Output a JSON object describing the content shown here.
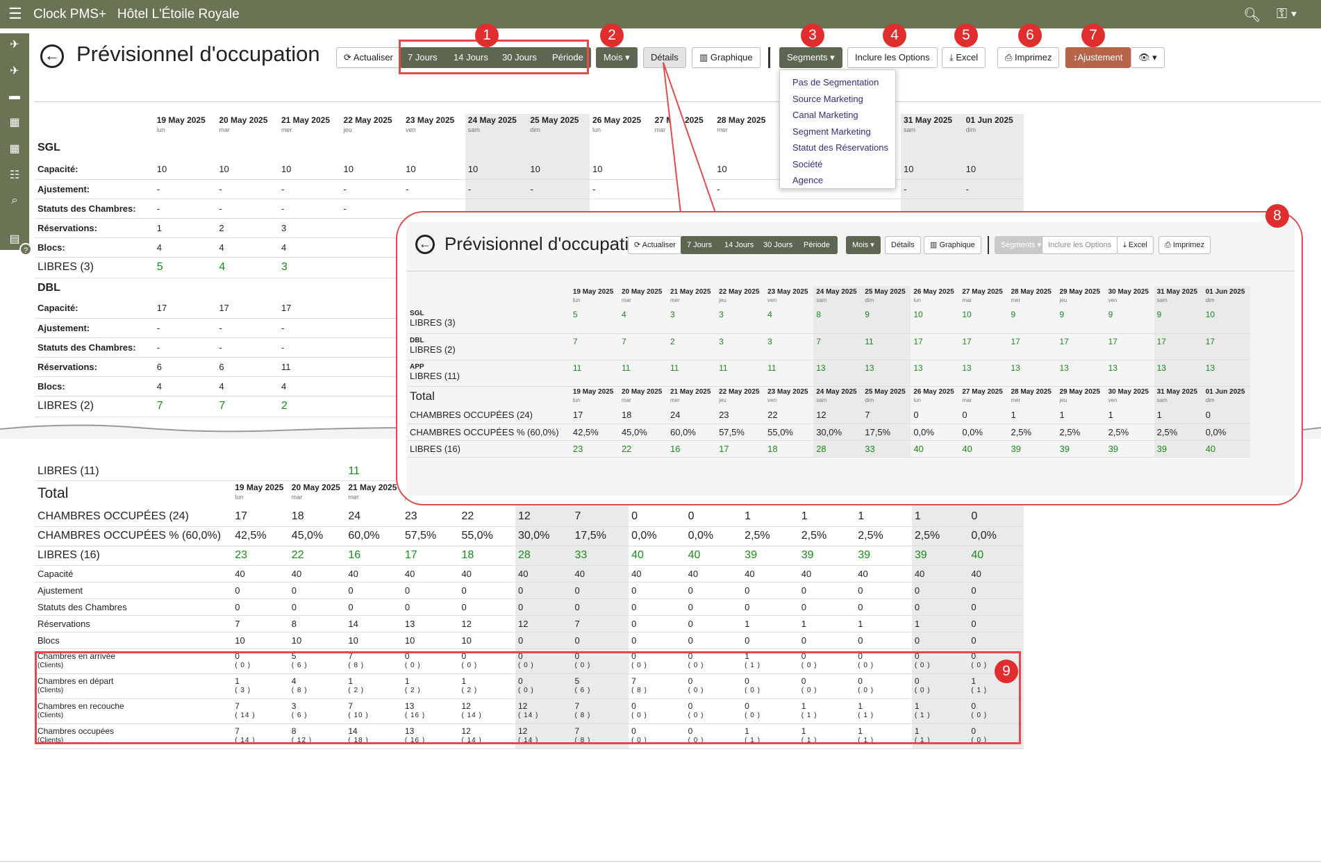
{
  "app": {
    "name": "Clock PMS+",
    "hotel": "Hôtel L'Étoile Royale"
  },
  "page": {
    "title": "Prévisionnel d'occupation"
  },
  "toolbar": {
    "refresh": "Actualiser",
    "d7": "7 Jours",
    "d14": "14 Jours",
    "d30": "30 Jours",
    "period": "Période",
    "month": "Mois",
    "details": "Détails",
    "graph": "Graphique",
    "segments": "Segments",
    "options": "Inclure les Options",
    "excel": "Excel",
    "print": "Imprimez",
    "adjust": "Ajustement"
  },
  "badges": [
    "1",
    "2",
    "3",
    "4",
    "5",
    "6",
    "7",
    "8",
    "9"
  ],
  "segment_menu": [
    "Pas de Segmentation",
    "Source Marketing",
    "Canal Marketing",
    "Segment Marketing",
    "Statut des Réservations",
    "Société",
    "Agence"
  ],
  "dates": [
    {
      "d": "19 May 2025",
      "w": "lun"
    },
    {
      "d": "20 May 2025",
      "w": "mar"
    },
    {
      "d": "21 May 2025",
      "w": "mer"
    },
    {
      "d": "22 May 2025",
      "w": "jeu"
    },
    {
      "d": "23 May 2025",
      "w": "ven"
    },
    {
      "d": "24 May 2025",
      "w": "sam"
    },
    {
      "d": "25 May 2025",
      "w": "dim"
    },
    {
      "d": "26 May 2025",
      "w": "lun"
    },
    {
      "d": "27 May 2025",
      "w": "mar"
    },
    {
      "d": "28 May 2025",
      "w": "mer"
    },
    {
      "d": "29 May 2025",
      "w": "jeu"
    },
    {
      "d": "30 May 2025",
      "w": "ven"
    },
    {
      "d": "31 May 2025",
      "w": "sam"
    },
    {
      "d": "01 Jun 2025",
      "w": "dim"
    }
  ],
  "main": {
    "sgl": {
      "name": "SGL",
      "rows": [
        {
          "label": "Capacité:",
          "vals": [
            "10",
            "10",
            "10",
            "10",
            "10",
            "10",
            "10",
            "10",
            "",
            "10",
            "",
            "",
            "10",
            "10"
          ]
        },
        {
          "label": "Ajustement:",
          "vals": [
            "-",
            "-",
            "-",
            "-",
            "-",
            "-",
            "-",
            "-",
            "",
            "-",
            "",
            "",
            "-",
            "-"
          ]
        },
        {
          "label": "Statuts des Chambres:",
          "vals": [
            "-",
            "-",
            "-",
            "-"
          ]
        },
        {
          "label": "Réservations:",
          "vals": [
            "1",
            "2",
            "3"
          ]
        },
        {
          "label": "Blocs:",
          "vals": [
            "4",
            "4",
            "4"
          ]
        }
      ],
      "free": {
        "label": "LIBRES (3)",
        "vals": [
          "5",
          "4",
          "3"
        ]
      }
    },
    "dbl": {
      "name": "DBL",
      "rows": [
        {
          "label": "Capacité:",
          "vals": [
            "17",
            "17",
            "17"
          ]
        },
        {
          "label": "Ajustement:",
          "vals": [
            "-",
            "-",
            "-"
          ]
        },
        {
          "label": "Statuts des Chambres:",
          "vals": [
            "-",
            "-",
            "-"
          ]
        },
        {
          "label": "Réservations:",
          "vals": [
            "6",
            "6",
            "11"
          ]
        },
        {
          "label": "Blocs:",
          "vals": [
            "4",
            "4",
            "4"
          ]
        }
      ],
      "free": {
        "label": "LIBRES (2)",
        "vals": [
          "7",
          "7",
          "2"
        ]
      }
    },
    "app_free": {
      "label": "LIBRES (11)",
      "vals": [
        "",
        "",
        "11"
      ]
    },
    "total": {
      "title": "Total",
      "occ": {
        "label": "CHAMBRES OCCUPÉES (24)",
        "vals": [
          "17",
          "18",
          "24",
          "23",
          "22",
          "12",
          "7",
          "0",
          "0",
          "1",
          "1",
          "1",
          "1",
          "0"
        ]
      },
      "pct": {
        "label": "CHAMBRES OCCUPÉES % (60,0%)",
        "vals": [
          "42,5%",
          "45,0%",
          "60,0%",
          "57,5%",
          "55,0%",
          "30,0%",
          "17,5%",
          "0,0%",
          "0,0%",
          "2,5%",
          "2,5%",
          "2,5%",
          "2,5%",
          "0,0%"
        ]
      },
      "free": {
        "label": "LIBRES (16)",
        "vals": [
          "23",
          "22",
          "16",
          "17",
          "18",
          "28",
          "33",
          "40",
          "40",
          "39",
          "39",
          "39",
          "39",
          "40"
        ]
      },
      "rows": [
        {
          "label": "Capacité",
          "vals": [
            "40",
            "40",
            "40",
            "40",
            "40",
            "40",
            "40",
            "40",
            "40",
            "40",
            "40",
            "40",
            "40",
            "40"
          ]
        },
        {
          "label": "Ajustement",
          "vals": [
            "0",
            "0",
            "0",
            "0",
            "0",
            "0",
            "0",
            "0",
            "0",
            "0",
            "0",
            "0",
            "0",
            "0"
          ]
        },
        {
          "label": "Statuts des Chambres",
          "vals": [
            "0",
            "0",
            "0",
            "0",
            "0",
            "0",
            "0",
            "0",
            "0",
            "0",
            "0",
            "0",
            "0",
            "0"
          ]
        },
        {
          "label": "Réservations",
          "vals": [
            "7",
            "8",
            "14",
            "13",
            "12",
            "12",
            "7",
            "0",
            "0",
            "1",
            "1",
            "1",
            "1",
            "0"
          ]
        },
        {
          "label": "Blocs",
          "vals": [
            "10",
            "10",
            "10",
            "10",
            "10",
            "0",
            "0",
            "0",
            "0",
            "0",
            "0",
            "0",
            "0",
            "0"
          ]
        }
      ],
      "guest_rows": [
        {
          "label": "Chambres en arrivée",
          "sub": "(Clients)",
          "vals": [
            "0",
            "5",
            "7",
            "0",
            "0",
            "0",
            "0",
            "0",
            "0",
            "1",
            "0",
            "0",
            "0",
            "0"
          ],
          "clients": [
            "( 0 )",
            "( 6 )",
            "( 8 )",
            "( 0 )",
            "( 0 )",
            "( 0 )",
            "( 0 )",
            "( 0 )",
            "( 0 )",
            "( 1 )",
            "( 0 )",
            "( 0 )",
            "( 0 )",
            "( 0 )"
          ]
        },
        {
          "label": "Chambres en départ",
          "sub": "(Clients)",
          "vals": [
            "1",
            "4",
            "1",
            "1",
            "1",
            "0",
            "5",
            "7",
            "0",
            "0",
            "0",
            "0",
            "0",
            "1"
          ],
          "clients": [
            "( 3 )",
            "( 8 )",
            "( 2 )",
            "( 2 )",
            "( 2 )",
            "( 0 )",
            "( 6 )",
            "( 8 )",
            "( 0 )",
            "( 0 )",
            "( 0 )",
            "( 0 )",
            "( 0 )",
            "( 1 )"
          ]
        },
        {
          "label": "Chambres en recouche",
          "sub": "(Clients)",
          "vals": [
            "7",
            "3",
            "7",
            "13",
            "12",
            "12",
            "7",
            "0",
            "0",
            "0",
            "1",
            "1",
            "1",
            "0"
          ],
          "clients": [
            "( 14 )",
            "( 6 )",
            "( 10 )",
            "( 16 )",
            "( 14 )",
            "( 14 )",
            "( 8 )",
            "( 0 )",
            "( 0 )",
            "( 0 )",
            "( 1 )",
            "( 1 )",
            "( 1 )",
            "( 0 )"
          ]
        },
        {
          "label": "Chambres occupées",
          "sub": "(Clients)",
          "vals": [
            "7",
            "8",
            "14",
            "13",
            "12",
            "12",
            "7",
            "0",
            "0",
            "1",
            "1",
            "1",
            "1",
            "0"
          ],
          "clients": [
            "( 14 )",
            "( 12 )",
            "( 18 )",
            "( 16 )",
            "( 14 )",
            "( 14 )",
            "( 8 )",
            "( 0 )",
            "( 0 )",
            "( 1 )",
            "( 1 )",
            "( 1 )",
            "( 1 )",
            "( 0 )"
          ]
        }
      ]
    }
  },
  "zoom": {
    "groups": [
      {
        "name": "SGL",
        "label": "LIBRES (3)",
        "vals": [
          "5",
          "4",
          "3",
          "3",
          "4",
          "8",
          "9",
          "10",
          "10",
          "9",
          "9",
          "9",
          "9",
          "10"
        ]
      },
      {
        "name": "DBL",
        "label": "LIBRES (2)",
        "vals": [
          "7",
          "7",
          "2",
          "3",
          "3",
          "7",
          "11",
          "17",
          "17",
          "17",
          "17",
          "17",
          "17",
          "17"
        ]
      },
      {
        "name": "APP",
        "label": "LIBRES (11)",
        "vals": [
          "11",
          "11",
          "11",
          "11",
          "11",
          "13",
          "13",
          "13",
          "13",
          "13",
          "13",
          "13",
          "13",
          "13"
        ]
      }
    ],
    "total": {
      "title": "Total",
      "occ": {
        "label": "CHAMBRES OCCUPÉES (24)",
        "vals": [
          "17",
          "18",
          "24",
          "23",
          "22",
          "12",
          "7",
          "0",
          "0",
          "1",
          "1",
          "1",
          "1",
          "0"
        ]
      },
      "pct": {
        "label": "CHAMBRES OCCUPÉES % (60,0%)",
        "vals": [
          "42,5%",
          "45,0%",
          "60,0%",
          "57,5%",
          "55,0%",
          "30,0%",
          "17,5%",
          "0,0%",
          "0,0%",
          "2,5%",
          "2,5%",
          "2,5%",
          "2,5%",
          "0,0%"
        ]
      },
      "free": {
        "label": "LIBRES (16)",
        "vals": [
          "23",
          "22",
          "16",
          "17",
          "18",
          "28",
          "33",
          "40",
          "40",
          "39",
          "39",
          "39",
          "39",
          "40"
        ]
      }
    }
  },
  "colors": {
    "topbar": "#6a7354",
    "accent_dark": "#5d6651",
    "badge": "#e02d2d",
    "free_green": "#1a8a1a",
    "adjust": "#b5654a"
  }
}
